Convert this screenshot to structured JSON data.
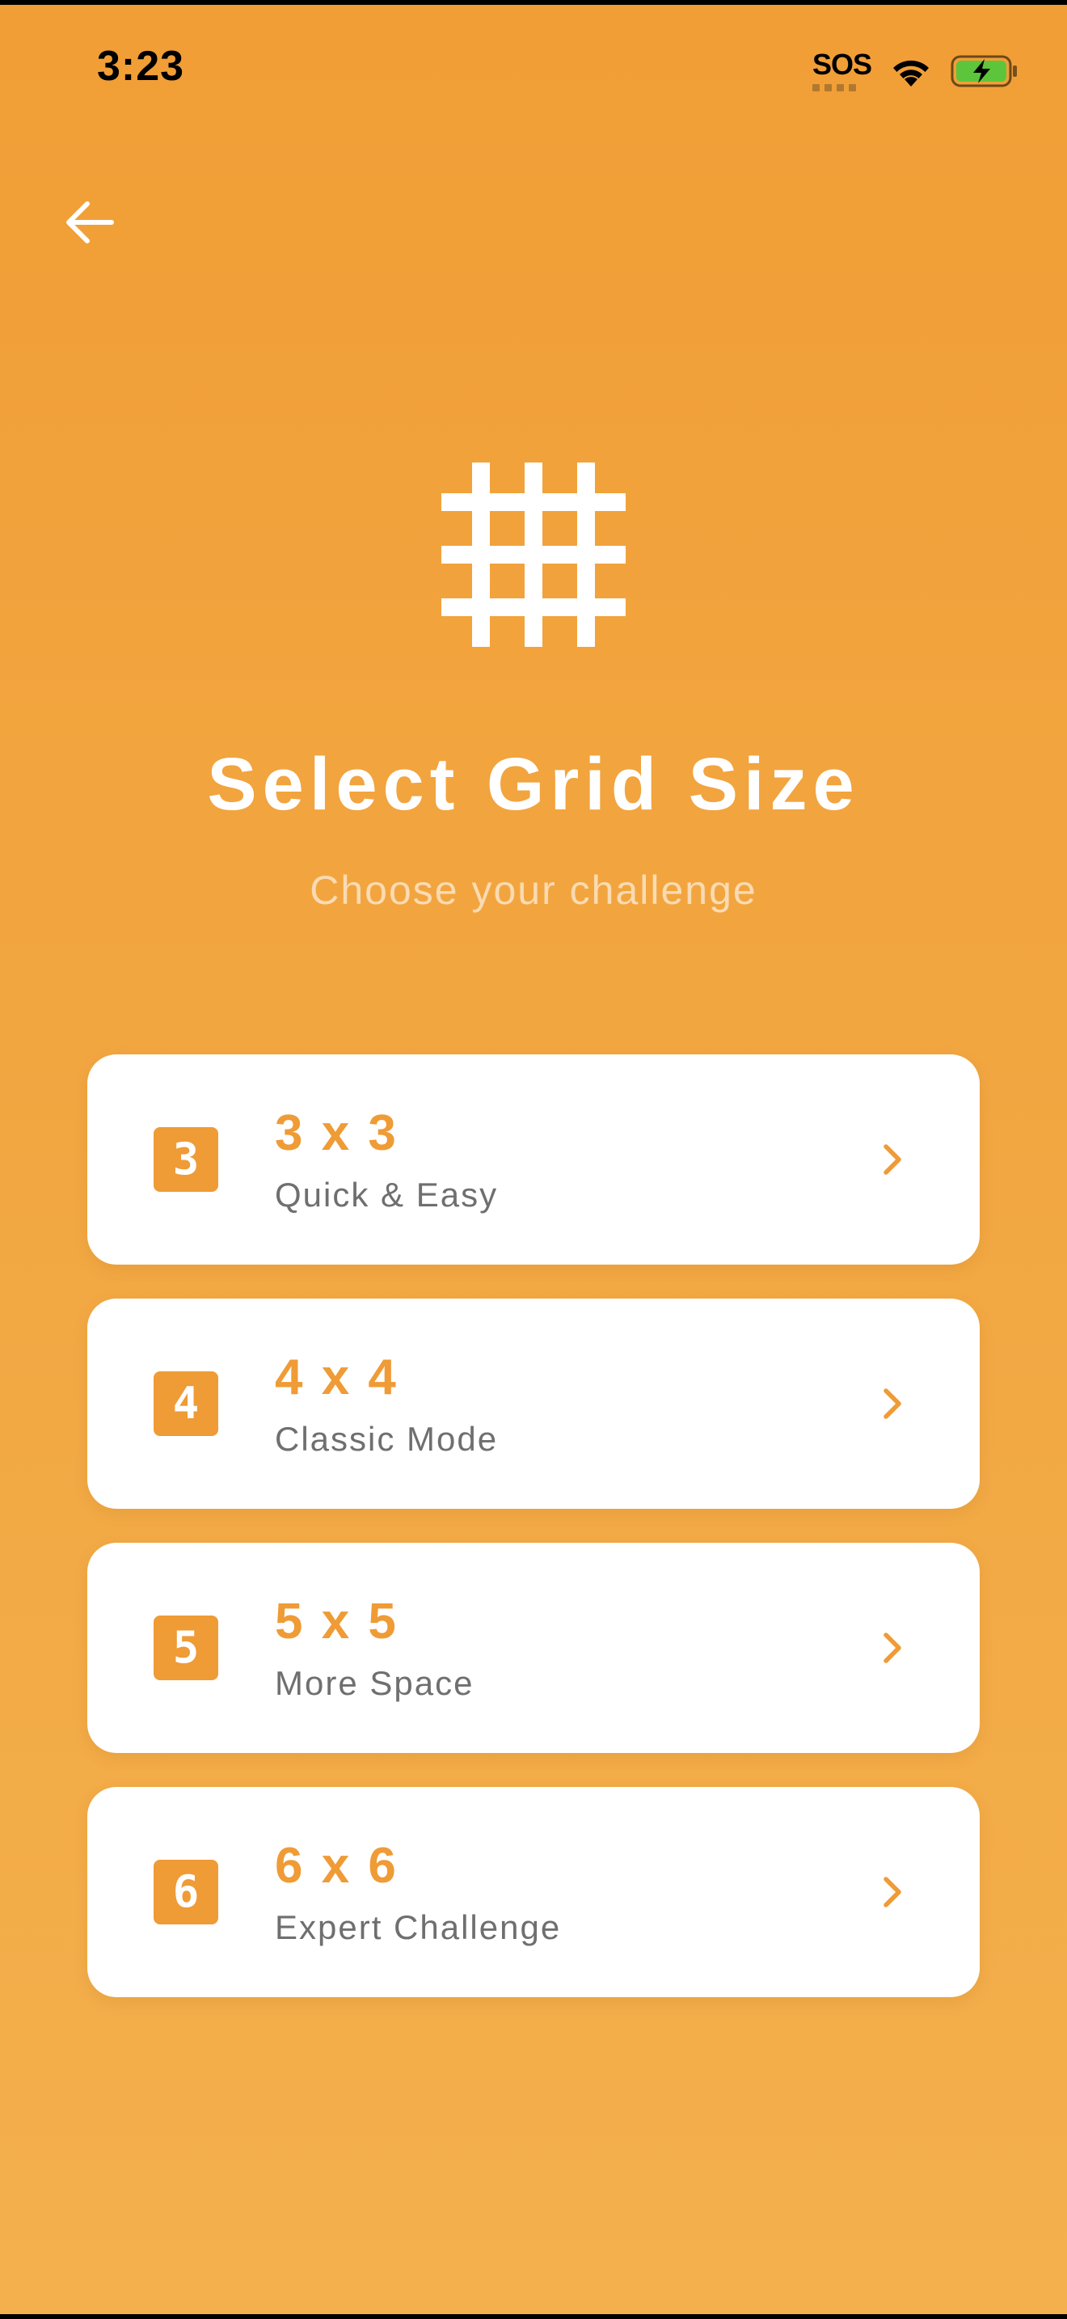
{
  "status_bar": {
    "time": "3:23",
    "sos": "SOS",
    "icons": [
      "wifi-icon",
      "battery-charging-icon"
    ]
  },
  "header": {
    "back_icon": "arrow-left-icon"
  },
  "hero": {
    "icon": "grid-hash-icon",
    "title": "Select Grid Size",
    "subtitle": "Choose your challenge"
  },
  "options": [
    {
      "badge": "3",
      "title": "3 x 3",
      "description": "Quick & Easy"
    },
    {
      "badge": "4",
      "title": "4 x 4",
      "description": "Classic Mode"
    },
    {
      "badge": "5",
      "title": "5 x 5",
      "description": "More Space"
    },
    {
      "badge": "6",
      "title": "6 x 6",
      "description": "Expert Challenge"
    }
  ],
  "colors": {
    "background_top": "#F19E36",
    "background_bottom": "#F3B04D",
    "accent": "#EF9B36",
    "card": "#FFFFFF",
    "description_text": "#6F6F6F"
  }
}
